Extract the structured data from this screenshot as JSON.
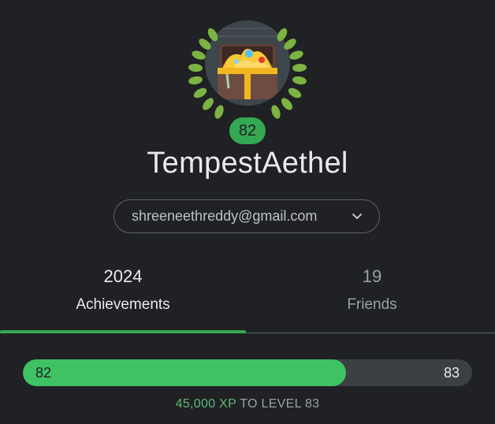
{
  "profile": {
    "username": "TempestAethel",
    "level": "82",
    "account_email": "shreeneethreddy@gmail.com"
  },
  "tabs": [
    {
      "count": "2024",
      "label": "Achievements",
      "selected": true
    },
    {
      "count": "19",
      "label": "Friends",
      "selected": false
    }
  ],
  "xp": {
    "current_level": "82",
    "next_level": "83",
    "progress_fraction": 0.72,
    "amount": "45,000 XP",
    "suffix": "TO LEVEL 83"
  },
  "colors": {
    "background": "#202124",
    "accent": "#34a853",
    "laurel": "#7cb342"
  },
  "icons": {
    "avatar": "treasure-chest-avatar",
    "laurel": "laurel-wreath-icon",
    "account_switcher": "chevron-down-icon"
  }
}
